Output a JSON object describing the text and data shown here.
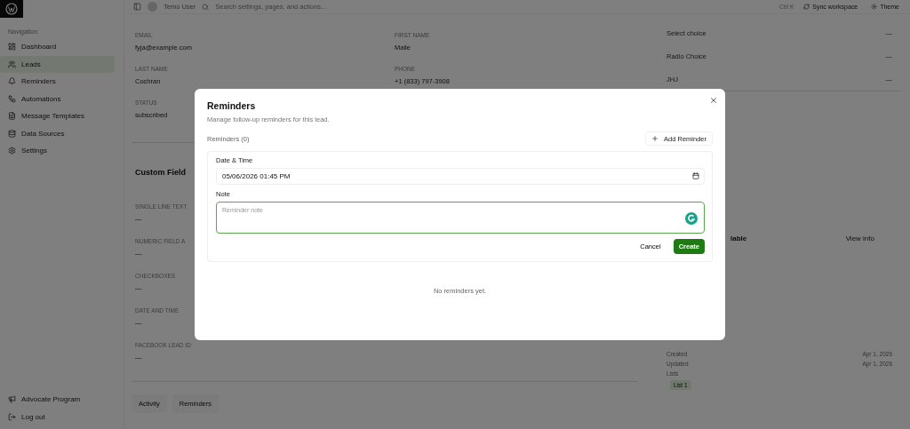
{
  "topbar": {
    "user": "Temo User",
    "search_placeholder": "Search settings, pages, and actions...",
    "shortcut": "Ctrl K",
    "sync": "Sync workspace",
    "theme": "Theme"
  },
  "sidebar": {
    "heading": "Navigation",
    "items": [
      {
        "label": "Dashboard",
        "selected": false
      },
      {
        "label": "Leads",
        "selected": true
      },
      {
        "label": "Reminders",
        "selected": false
      },
      {
        "label": "Automations",
        "selected": false
      },
      {
        "label": "Message Templates",
        "selected": false
      },
      {
        "label": "Data Sources",
        "selected": false
      },
      {
        "label": "Settings",
        "selected": false
      }
    ],
    "footer": [
      {
        "label": "Advocate Program"
      },
      {
        "label": "Log out"
      }
    ]
  },
  "lead": {
    "fields": [
      {
        "label": "EMAIL",
        "value": "fyja@example.com"
      },
      {
        "label": "FIRST NAME",
        "value": "Maile"
      },
      {
        "label": "LAST NAME",
        "value": "Cochran"
      },
      {
        "label": "PHONE",
        "value": "+1 (833) 797-3908"
      },
      {
        "label": "STATUS",
        "value": "subscribed"
      }
    ]
  },
  "custom_fields": {
    "title": "Custom Field",
    "fields": [
      {
        "label": "SINGLE LINE TEXT",
        "value": "—"
      },
      {
        "label": "NUMERIC FIELD A",
        "value": "—"
      },
      {
        "label": "CHECKBOXES",
        "value": "—"
      },
      {
        "label": "DATE AND TIME",
        "value": "—"
      },
      {
        "label": "FACEBOOK LEAD ID",
        "value": "—"
      }
    ]
  },
  "bottom_tabs": [
    {
      "label": "Activity"
    },
    {
      "label": "Reminders"
    }
  ],
  "right_panel": {
    "choices": [
      {
        "label": "Select choice",
        "value": "—"
      },
      {
        "label": "Radio Choice",
        "value": "—"
      },
      {
        "label": "JHJ",
        "value": "—"
      }
    ],
    "enrichment": {
      "title": "lable",
      "action": "View info"
    },
    "meta": [
      {
        "label": "Created",
        "value": "Apr 1, 2026"
      },
      {
        "label": "Updated",
        "value": "Apr 1, 2026"
      }
    ],
    "lists_label": "Lists",
    "lists": [
      "List 1"
    ]
  },
  "modal": {
    "title": "Reminders",
    "subtitle": "Manage follow-up reminders for this lead.",
    "count": "Reminders (0)",
    "add_button": "Add Reminder",
    "form": {
      "date_label": "Date & Time",
      "date_value": "05/06/2026 01:45 PM",
      "note_label": "Note",
      "note_placeholder": "Reminder note",
      "cancel": "Cancel",
      "create": "Create"
    },
    "empty": "No reminders yet."
  }
}
